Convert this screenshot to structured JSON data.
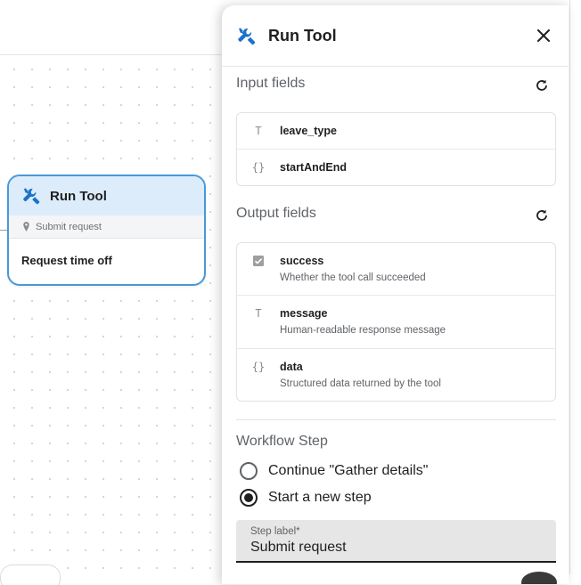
{
  "node": {
    "title": "Run Tool",
    "subtitle": "Submit request",
    "body": "Request time off"
  },
  "panel": {
    "title": "Run Tool",
    "input_section": {
      "label": "Input fields",
      "fields": [
        {
          "type_icon": "T",
          "name": "leave_type"
        },
        {
          "type_icon": "{}",
          "name": "startAndEnd"
        }
      ]
    },
    "output_section": {
      "label": "Output fields",
      "fields": [
        {
          "type_icon": "checkbox",
          "name": "success",
          "description": "Whether the tool call succeeded"
        },
        {
          "type_icon": "T",
          "name": "message",
          "description": "Human-readable response message"
        },
        {
          "type_icon": "{}",
          "name": "data",
          "description": "Structured data returned by the tool"
        }
      ]
    },
    "workflow": {
      "label": "Workflow Step",
      "options": [
        {
          "label": "Continue \"Gather details\"",
          "checked": false
        },
        {
          "label": "Start a new step",
          "checked": true
        }
      ],
      "step_label_field": {
        "label": "Step label*",
        "value": "Submit request"
      }
    }
  },
  "colors": {
    "accent": "#4a98d8",
    "node_header_bg": "#dcecfb",
    "icon_blue": "#1a73c9"
  }
}
